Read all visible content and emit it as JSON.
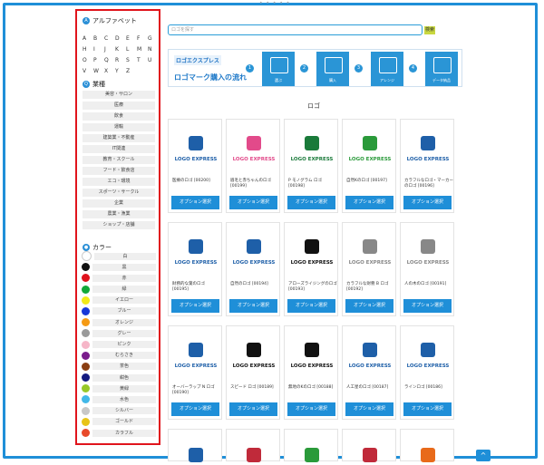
{
  "sidebar": {
    "alpha_title": "アルファベット",
    "letters": [
      "A",
      "B",
      "C",
      "D",
      "E",
      "F",
      "G",
      "H",
      "I",
      "J",
      "K",
      "L",
      "M",
      "N",
      "O",
      "P",
      "Q",
      "R",
      "S",
      "T",
      "U",
      "V",
      "W",
      "X",
      "Y",
      "Z"
    ],
    "industry_title": "業種",
    "industries": [
      "美容・サロン",
      "医療",
      "飲食",
      "運輸",
      "建築業・不動産",
      "IT関連",
      "教育・スクール",
      "フード・飲食店",
      "エコ・環境",
      "スポーツ・サークル",
      "企業",
      "農業・漁業",
      "ショップ・店舗"
    ],
    "color_title": "カラー",
    "colors": [
      {
        "label": "白",
        "hex": "#ffffff"
      },
      {
        "label": "黒",
        "hex": "#111111"
      },
      {
        "label": "赤",
        "hex": "#e0121c"
      },
      {
        "label": "緑",
        "hex": "#12a838"
      },
      {
        "label": "イエロー",
        "hex": "#f2ea18"
      },
      {
        "label": "ブルー",
        "hex": "#1838d8"
      },
      {
        "label": "オレンジ",
        "hex": "#f59a14"
      },
      {
        "label": "グレー",
        "hex": "#9a9a9a"
      },
      {
        "label": "ピンク",
        "hex": "#f6b6c8"
      },
      {
        "label": "むらさき",
        "hex": "#7a1c8c"
      },
      {
        "label": "茶色",
        "hex": "#8a3e12"
      },
      {
        "label": "紺色",
        "hex": "#141a80"
      },
      {
        "label": "黄緑",
        "hex": "#98c828"
      },
      {
        "label": "水色",
        "hex": "#42b8e8"
      },
      {
        "label": "シルバー",
        "hex": "#c8c8c8"
      },
      {
        "label": "ゴールド",
        "hex": "#e8c418"
      },
      {
        "label": "カラフル",
        "hex": "#e84a2a"
      }
    ]
  },
  "search": {
    "placeholder": "ロゴを探す",
    "button": "検索"
  },
  "banner": {
    "brand": "ロゴエクスプレス",
    "title": "ロゴマーク購入の流れ",
    "steps": [
      "選ぶ",
      "購入",
      "アレンジ",
      "データ納品"
    ],
    "nums": [
      "1",
      "2",
      "3",
      "4"
    ]
  },
  "section_title": "ロゴ",
  "cards": [
    {
      "brand": "LOGO EXPRESS",
      "caption": "医療のロゴ [00200]",
      "color": "#1e5fa8"
    },
    {
      "brand": "LOGO EXPRESS",
      "caption": "眉毛と赤ちゃんのロゴ [00199]",
      "color": "#e24a8a"
    },
    {
      "brand": "LOGO EXPRESS",
      "caption": "P モノグラム ロゴ [00198]",
      "color": "#1a7a3a"
    },
    {
      "brand": "LOGO EXPRESS",
      "caption": "自然Kのロゴ [00197]",
      "color": "#2a9a3a"
    },
    {
      "brand": "LOGO EXPRESS",
      "caption": "カラフルなロゴ・マーカーのロゴ [00196]",
      "color": "#1e5fa8"
    },
    {
      "brand": "LOGO EXPRESS",
      "caption": "財務的な葉のロゴ [00195]",
      "color": "#1e5fa8"
    },
    {
      "brand": "LOGO EXPRESS",
      "caption": "自然のロゴ [00194]",
      "color": "#1e5fa8"
    },
    {
      "brand": "LOGO EXPRESS",
      "caption": "アローズライジングのロゴ [00193]",
      "color": "#111111"
    },
    {
      "brand": "LOGO EXPRESS",
      "caption": "カラフルな財務 B ロゴ [00192]",
      "color": "#888888"
    },
    {
      "brand": "LOGO EXPRESS",
      "caption": "人の木のロゴ [00191]",
      "color": "#888888"
    },
    {
      "brand": "LOGO EXPRESS",
      "caption": "オーバーラップ N ロゴ [00190]",
      "color": "#1e5fa8"
    },
    {
      "brand": "LOGO EXPRESS",
      "caption": "スピード ロゴ [00189]",
      "color": "#111111"
    },
    {
      "brand": "LOGO EXPRESS",
      "caption": "無地のKのロゴ [00188]",
      "color": "#111111"
    },
    {
      "brand": "LOGO EXPRESS",
      "caption": "人工星のロゴ [00187]",
      "color": "#1e5fa8"
    },
    {
      "brand": "LOGO EXPRESS",
      "caption": "ラインロゴ [00186]",
      "color": "#1e5fa8"
    }
  ],
  "option_label": "オプション選択",
  "to_top": "^"
}
